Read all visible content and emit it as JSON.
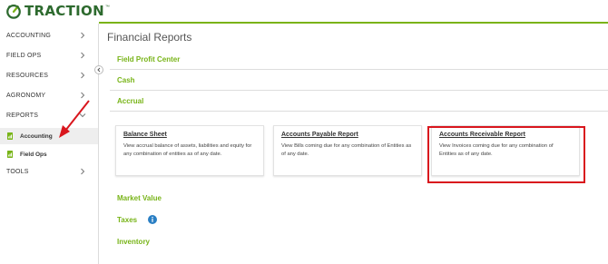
{
  "brand": {
    "name": "TRACTION",
    "tm": "™"
  },
  "sidebar": {
    "items": [
      {
        "label": "ACCOUNTING"
      },
      {
        "label": "FIELD OPS"
      },
      {
        "label": "RESOURCES"
      },
      {
        "label": "AGRONOMY"
      },
      {
        "label": "REPORTS"
      },
      {
        "label": "TOOLS"
      }
    ],
    "subitems": [
      {
        "label": "Accounting"
      },
      {
        "label": "Field Ops"
      }
    ]
  },
  "main": {
    "title": "Financial Reports",
    "sections": [
      {
        "label": "Field Profit Center"
      },
      {
        "label": "Cash"
      },
      {
        "label": "Accrual"
      },
      {
        "label": "Market Value"
      },
      {
        "label": "Taxes"
      },
      {
        "label": "Inventory"
      }
    ],
    "cards": [
      {
        "title": "Balance Sheet",
        "desc": "View accrual balance of assets, liabilities and equity for any combination of entities as of any date."
      },
      {
        "title": "Accounts Payable Report",
        "desc": "View Bills coming due for any combination of Entities as of any date."
      },
      {
        "title": "Accounts Receivable Report",
        "desc": "View Invoices coming due for any combination of Entities as of any date."
      }
    ]
  },
  "colors": {
    "accent": "#78b418",
    "brand": "#2d6a2e",
    "highlight": "#d9161d",
    "info": "#2a7fc4"
  }
}
